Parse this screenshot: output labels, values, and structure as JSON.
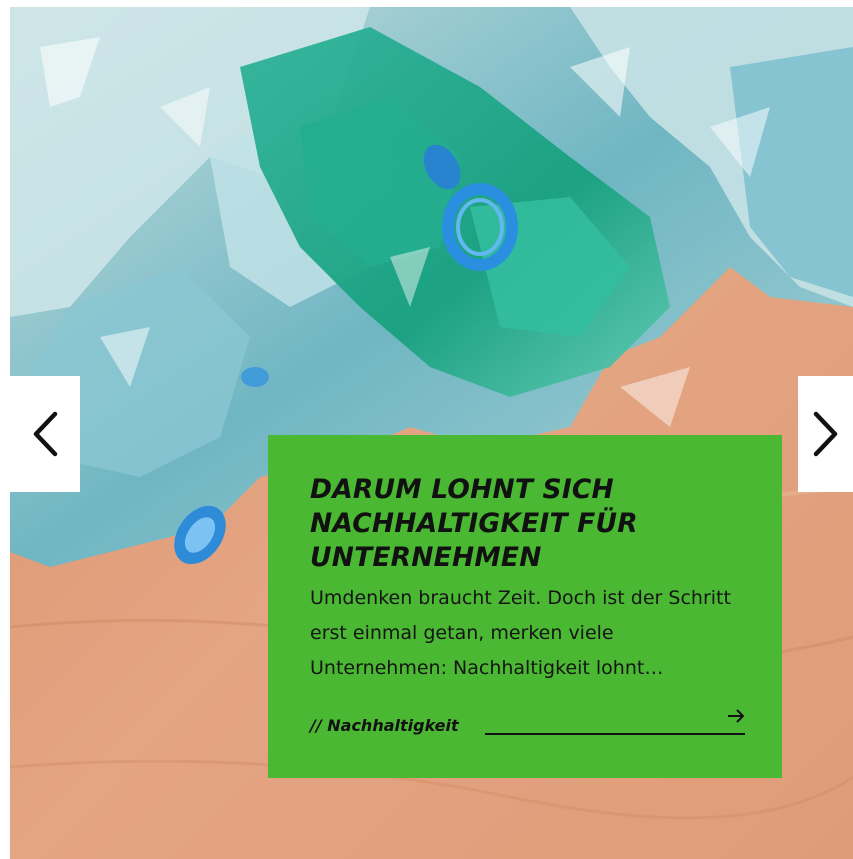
{
  "slider": {
    "nav": {
      "prev_icon": "chevron-left-icon",
      "next_icon": "chevron-right-icon"
    },
    "image": {
      "subject": "crushed plastic bottles on kraft paper"
    },
    "card": {
      "title": "DARUM LOHNT SICH NACHHALTIGKEIT FÜR UNTERNEHMEN",
      "excerpt": "Umdenken braucht Zeit. Doch ist der Schritt erst einmal getan, merken viele Unternehmen: Nachhaltigkeit lohnt…",
      "category": "// Nachhaltigkeit",
      "link_icon": "arrow-right-icon",
      "background": "#4ab832"
    }
  }
}
